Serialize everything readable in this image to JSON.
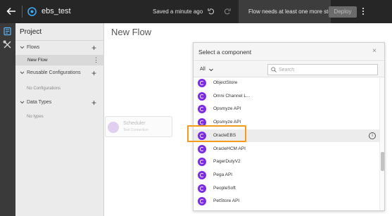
{
  "topbar": {
    "title": "ebs_test",
    "saved_status": "Saved a minute ago",
    "warning": "Flow needs at least one more step",
    "deploy_label": "Deploy"
  },
  "project": {
    "title": "Project",
    "sections": {
      "flows": "Flows",
      "flow_item": "New Flow",
      "reusable": "Reusable Configurations",
      "reusable_empty": "No Configurations",
      "data_types": "Data Types",
      "data_types_empty": "No types"
    }
  },
  "canvas": {
    "title": "New Flow",
    "node_title": "Scheduler",
    "node_subtitle": "Test Connection"
  },
  "dialog": {
    "title": "Select a component",
    "filter_value": "All",
    "search_placeholder": "Search",
    "items": [
      "ObjectStore",
      "Omni Channel L...",
      "Opsmyze API",
      "Opsmyze API",
      "OracleEBS",
      "OracleHCM API",
      "PagerDutyV2",
      "Pega API",
      "PeopleSoft",
      "PetStore API"
    ],
    "highlighted_item": "OracleEBS"
  },
  "colors": {
    "topbar_bg": "#262626",
    "component_icon": "#7d2ae8",
    "focus_outline": "#f59b1c"
  }
}
